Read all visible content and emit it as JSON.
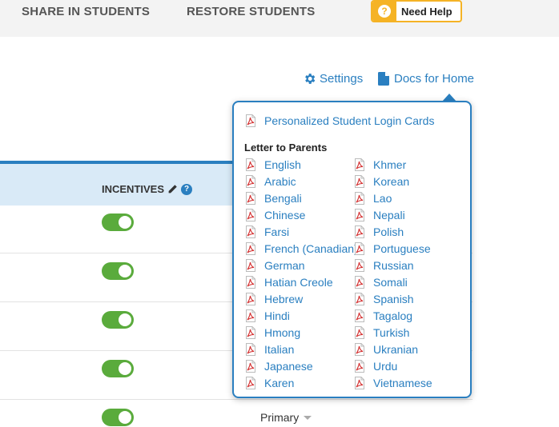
{
  "topbar": {
    "share_label": "SHARE IN STUDENTS",
    "restore_label": "RESTORE STUDENTS",
    "need_help_label": "Need Help"
  },
  "actions": {
    "settings_label": "Settings",
    "docs_label": "Docs for Home"
  },
  "table": {
    "incentives_header": "INCENTIVES",
    "rows": [
      {
        "incentives_on": true
      },
      {
        "incentives_on": true
      },
      {
        "incentives_on": true
      },
      {
        "incentives_on": true
      },
      {
        "incentives_on": true,
        "level": "Primary"
      }
    ]
  },
  "popover": {
    "login_cards_label": "Personalized Student Login Cards",
    "letter_header": "Letter to Parents",
    "languages_col1": [
      "English",
      "Arabic",
      "Bengali",
      "Chinese",
      "Farsi",
      "French (Canadian)",
      "German",
      "Hatian Creole",
      "Hebrew",
      "Hindi",
      "Hmong",
      "Italian",
      "Japanese",
      "Karen"
    ],
    "languages_col2": [
      "Khmer",
      "Korean",
      "Lao",
      "Nepali",
      "Polish",
      "Portuguese",
      "Russian",
      "Somali",
      "Spanish",
      "Tagalog",
      "Turkish",
      "Ukranian",
      "Urdu",
      "Vietnamese"
    ]
  },
  "colors": {
    "accent": "#2a7fc0",
    "help_border": "#f5b325",
    "toggle_on": "#5aab3c",
    "pdf_red": "#d32f2f"
  }
}
